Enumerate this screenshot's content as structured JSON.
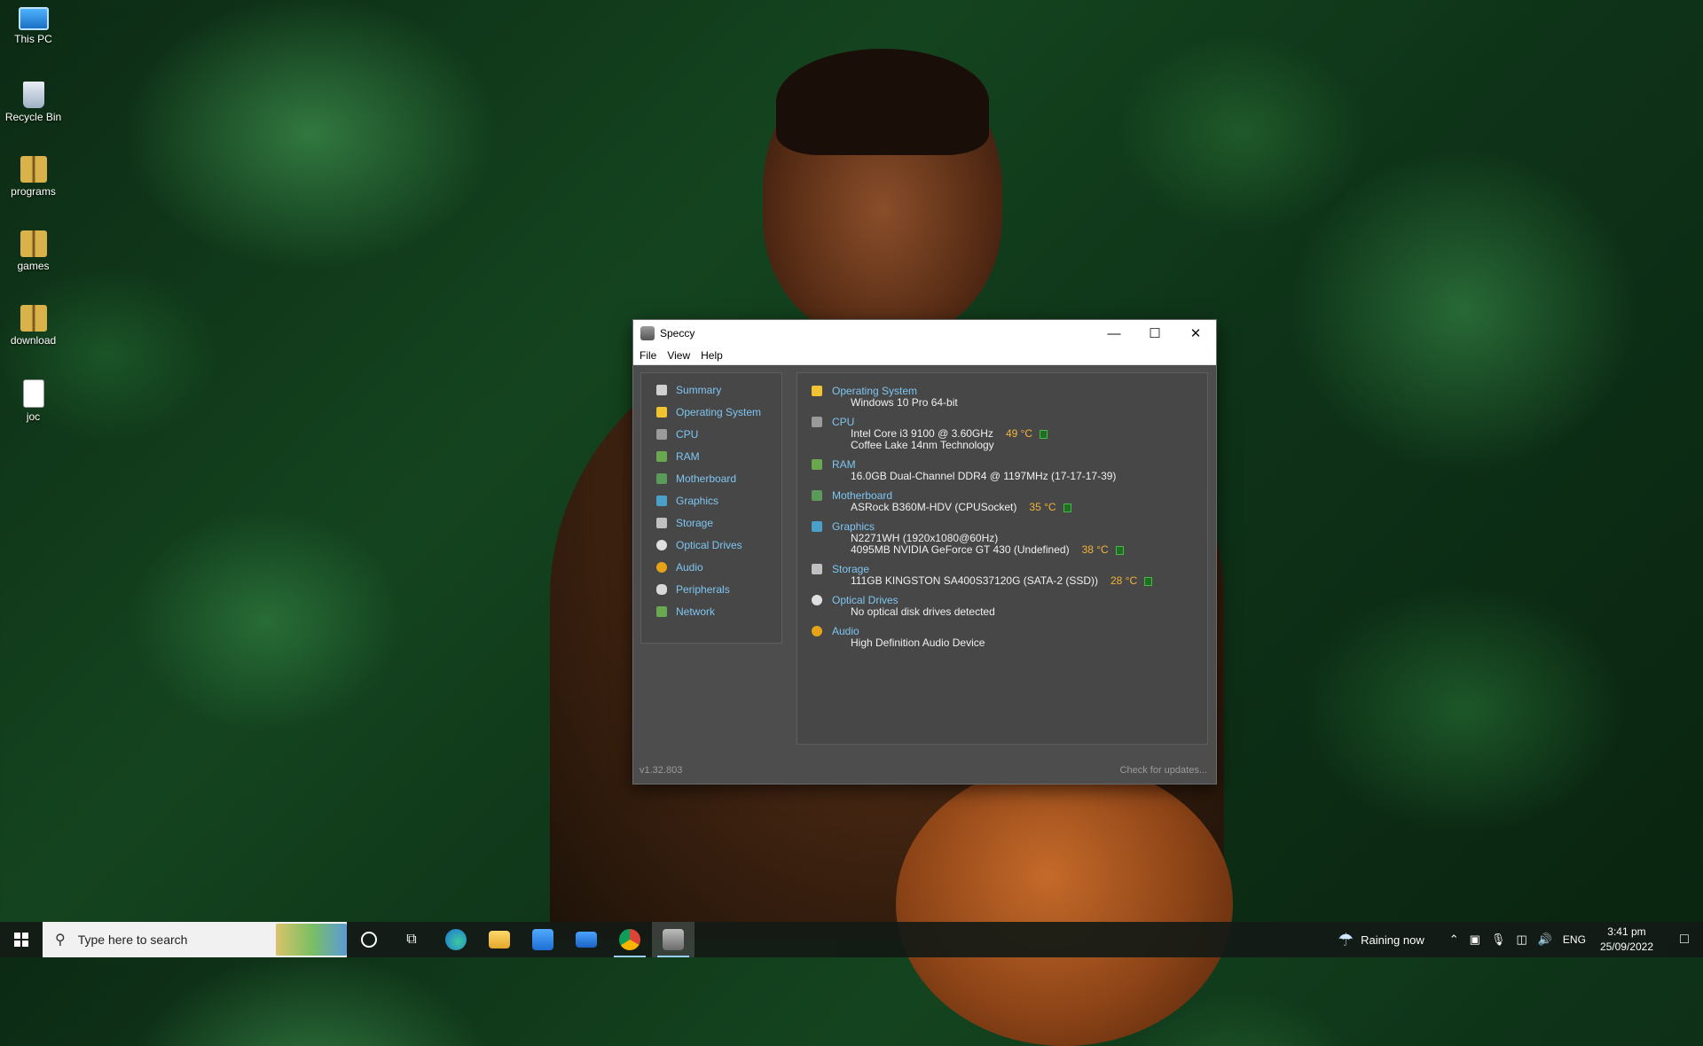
{
  "desktop": {
    "icons": [
      {
        "label": "This PC",
        "icon": "this-pc-icon"
      },
      {
        "label": "Recycle Bin",
        "icon": "recycle-bin-icon"
      },
      {
        "label": "programs",
        "icon": "zip-folder-icon"
      },
      {
        "label": "games",
        "icon": "zip-folder-icon"
      },
      {
        "label": "download",
        "icon": "zip-folder-icon"
      },
      {
        "label": "joc",
        "icon": "file-icon"
      }
    ]
  },
  "window": {
    "title": "Speccy",
    "menu": [
      "File",
      "View",
      "Help"
    ],
    "nav": [
      {
        "label": "Summary",
        "color": "#d0d0d0"
      },
      {
        "label": "Operating System",
        "color": "#f1c232"
      },
      {
        "label": "CPU",
        "color": "#9a9a9a"
      },
      {
        "label": "RAM",
        "color": "#6aa84f"
      },
      {
        "label": "Motherboard",
        "color": "#5a9a5a"
      },
      {
        "label": "Graphics",
        "color": "#4aa0c8"
      },
      {
        "label": "Storage",
        "color": "#c0c0c0"
      },
      {
        "label": "Optical Drives",
        "color": "#e0e0e0"
      },
      {
        "label": "Audio",
        "color": "#e6a317"
      },
      {
        "label": "Peripherals",
        "color": "#d8d8d8"
      },
      {
        "label": "Network",
        "color": "#6aa84f"
      }
    ],
    "summary": {
      "os": {
        "title": "Operating System",
        "lines": [
          "Windows 10 Pro 64-bit"
        ]
      },
      "cpu": {
        "title": "CPU",
        "line1": "Intel Core i3 9100 @ 3.60GHz",
        "temp": "49 °C",
        "line2": "Coffee Lake 14nm Technology"
      },
      "ram": {
        "title": "RAM",
        "line1": "16.0GB Dual-Channel DDR4 @ 1197MHz (17-17-17-39)"
      },
      "motherboard": {
        "title": "Motherboard",
        "line1": "ASRock B360M-HDV (CPUSocket)",
        "temp": "35 °C"
      },
      "graphics": {
        "title": "Graphics",
        "line1": "N2271WH (1920x1080@60Hz)",
        "line2": "4095MB NVIDIA GeForce GT 430 (Undefined)",
        "temp": "38 °C"
      },
      "storage": {
        "title": "Storage",
        "line1": "111GB KINGSTON SA400S37120G (SATA-2 (SSD))",
        "temp": "28 °C"
      },
      "optical": {
        "title": "Optical Drives",
        "line1": "No optical disk drives detected"
      },
      "audio": {
        "title": "Audio",
        "line1": "High Definition Audio Device"
      }
    },
    "version": "v1.32.803",
    "check_updates": "Check for updates..."
  },
  "taskbar": {
    "search_placeholder": "Type here to search",
    "weather": "Raining now",
    "language": "ENG",
    "time": "3:41 pm",
    "date": "25/09/2022"
  }
}
